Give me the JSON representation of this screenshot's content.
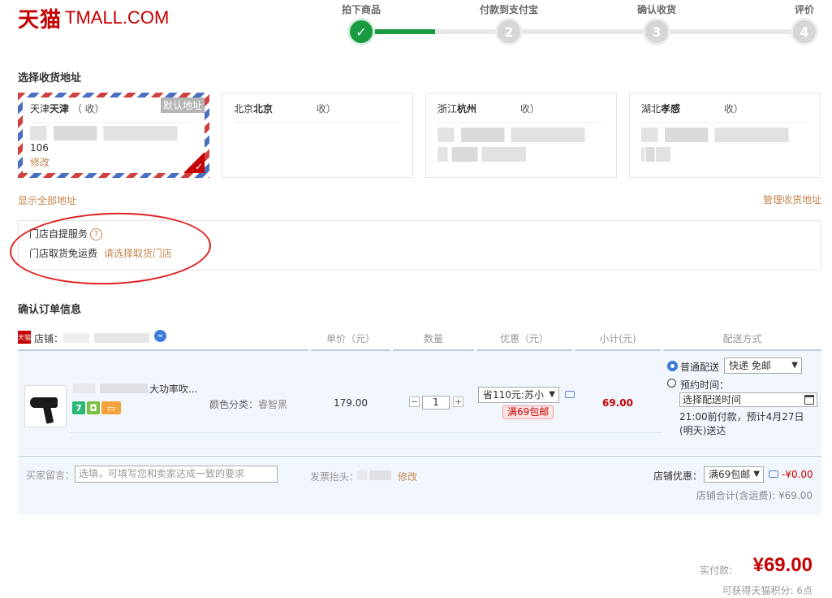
{
  "logo": {
    "cn": "天猫",
    "en": "TMALL.COM"
  },
  "steps": [
    {
      "label": "拍下商品",
      "num": "✓",
      "done": true
    },
    {
      "label": "付款到支付宝",
      "num": "2",
      "done": false
    },
    {
      "label": "确认收货",
      "num": "3",
      "done": false
    },
    {
      "label": "评价",
      "num": "4",
      "done": false
    }
  ],
  "address": {
    "title": "选择收货地址",
    "cards": [
      {
        "province": "天津",
        "city": "天津",
        "recv": "（ 收）",
        "line1": "106",
        "edit": "修改",
        "default_tag": "默认地址"
      },
      {
        "province": "北京",
        "city": "北京",
        "recv": "收）"
      },
      {
        "province": "浙江",
        "city": "杭州",
        "recv": "收）"
      },
      {
        "province": "湖北",
        "city": "孝感",
        "recv": "收）"
      }
    ],
    "show_all": "显示全部地址",
    "manage": "管理收货地址"
  },
  "pickup": {
    "title": "门店自提服务",
    "help_icon": "question-icon",
    "free": "门店取货免运费",
    "choose": "请选择取货门店"
  },
  "order": {
    "title": "确认订单信息",
    "store_label": "店铺：",
    "headers": [
      "单价（元）",
      "数量",
      "优惠（元）",
      "小计(元)",
      "配送方式"
    ],
    "product": {
      "title": "大功率吹...",
      "sku_label": "颜色分类：",
      "sku_value": "睿智黑",
      "price": "179.00",
      "qty": "1",
      "discount_select": "省110元:苏小",
      "promo": "满69包邮",
      "subtotal": "69.00"
    },
    "delivery": {
      "normal": "普通配送",
      "method": "快递 免邮",
      "scheduled": "预约时间：",
      "date_placeholder": "选择配送时间",
      "note": "21:00前付款，预计4月27日(明天)送达"
    }
  },
  "footer": {
    "message_label": "买家留言：",
    "message_placeholder": "选填，可填写您和卖家达成一致的要求",
    "invoice_label": "发票抬头：",
    "invoice_edit": "修改",
    "store_discount_label": "店铺优惠：",
    "store_discount_select": "满69包邮",
    "store_discount_value": "-¥0.00",
    "store_total": "店铺合计(含运费): ¥69.00"
  },
  "payment": {
    "label": "实付款:",
    "amount": "¥69.00",
    "points": "可获得天猫积分: 6点"
  }
}
